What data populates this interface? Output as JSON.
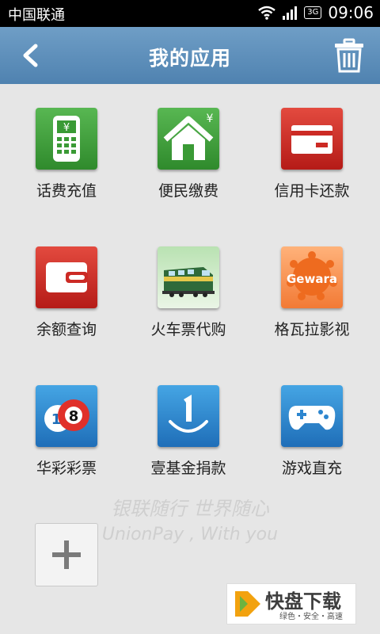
{
  "status_bar": {
    "carrier": "中国联通",
    "network_badge": "3G",
    "time": "09:06",
    "icons": [
      "wifi-icon",
      "signal-icon",
      "battery-icon"
    ]
  },
  "header": {
    "title": "我的应用",
    "back_icon": "back-arrow-icon",
    "delete_icon": "trash-icon"
  },
  "apps": [
    {
      "label": "话费充值",
      "icon": "phone-recharge-icon"
    },
    {
      "label": "便民缴费",
      "icon": "house-yen-icon"
    },
    {
      "label": "信用卡还款",
      "icon": "credit-card-icon"
    },
    {
      "label": "余额查询",
      "icon": "wallet-icon"
    },
    {
      "label": "火车票代购",
      "icon": "train-icon"
    },
    {
      "label": "格瓦拉影视",
      "icon": "gewara-logo-icon",
      "logo_text": "Gewara"
    },
    {
      "label": "华彩彩票",
      "icon": "lottery-balls-icon"
    },
    {
      "label": "壹基金捐款",
      "icon": "one-foundation-icon"
    },
    {
      "label": "游戏直充",
      "icon": "gamepad-icon"
    }
  ],
  "slogan": {
    "cn": "银联随行  世界随心",
    "en": "UnionPay , With you"
  },
  "add_button_icon": "plus-icon",
  "watermark": {
    "brand": "快盘下载",
    "tagline": "绿色・安全・高速"
  },
  "colors": {
    "header": "#5b8cb9",
    "background": "#e6e6e6",
    "green_tile": "#3a9a35",
    "red_tile": "#cc2a24",
    "blue_tile": "#2d86cf"
  }
}
